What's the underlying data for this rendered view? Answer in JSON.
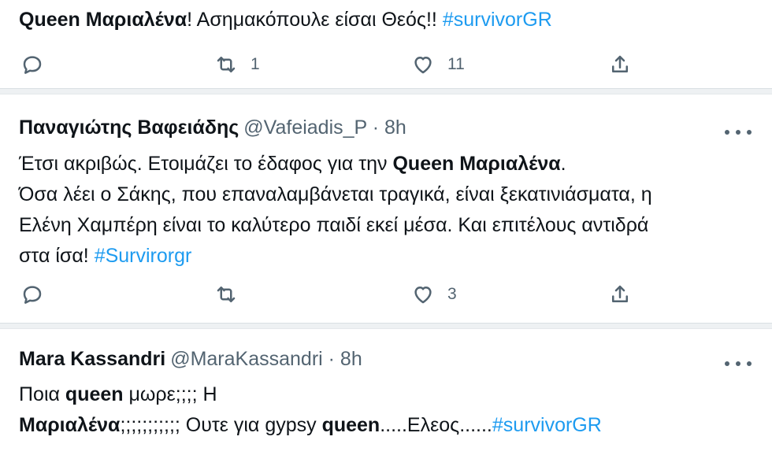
{
  "tweets": [
    {
      "text_parts": [
        {
          "t": "Queen Μαριαλένα",
          "style": "bold"
        },
        {
          "t": "! Ασημακόπουλε είσαι Θεός!! ",
          "style": "normal"
        },
        {
          "t": "#survivorGR",
          "style": "tag"
        }
      ],
      "actions": {
        "reply": "",
        "retweet": "1",
        "like": "11"
      }
    },
    {
      "name": "Παναγιώτης Βαφειάδης",
      "handle": "@Vafeiadis_P · 8h",
      "lines": [
        "Έτσι ακριβώς. Ετοιμάζει το έδαφος για την ",
        "Queen Μαριαλένα",
        ".",
        "Όσα λέει ο Σάκης, που επαναλαμβάνεται τραγικά, είναι ξεκατινιάσματα, η",
        "Ελένη Χαμπέρη είναι το καλύτερο παιδί εκεί μέσα. Και επιτέλους αντιδρά",
        "στα ίσα! ",
        "#Survirorgr"
      ],
      "actions": {
        "reply": "",
        "retweet": "",
        "like": "3"
      }
    },
    {
      "name": "Mara Kassandri",
      "handle": "@MaraKassandri · 8h",
      "line1": [
        "Ποια ",
        "queen",
        " μωρε;;;; Η"
      ],
      "line2": [
        "Μαριαλένα",
        ";;;;;;;;;;; Ουτε για gypsy ",
        "queen",
        ".....Ελεος......",
        "#survivorGR"
      ]
    }
  ],
  "colors": {
    "text": "#0f1419",
    "secondary": "#536471",
    "link": "#1d9bf0",
    "divider": "#eef1f3"
  },
  "icons": [
    "reply-icon",
    "retweet-icon",
    "like-icon",
    "share-icon",
    "more-icon"
  ]
}
